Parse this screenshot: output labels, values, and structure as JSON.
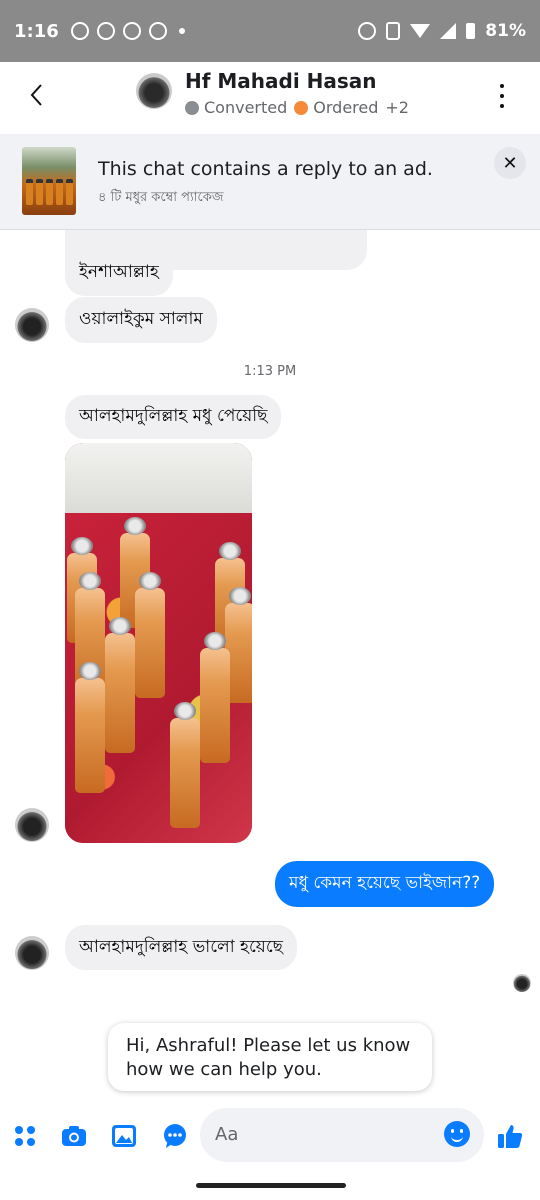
{
  "status_bar": {
    "time": "1:16",
    "battery": "81%"
  },
  "header": {
    "contact_name": "Hf Mahadi Hasan",
    "labels": [
      {
        "text": "Converted",
        "color": "#8a8d91"
      },
      {
        "text": "Ordered",
        "color": "#f58b3a"
      }
    ],
    "more_labels": "+2"
  },
  "ad_banner": {
    "title": "This chat contains a reply to an ad.",
    "subtitle": "৪ টি মধুর কম্বো প্যাকেজ"
  },
  "messages": {
    "partial_prev": "ইনশাআল্লাহ",
    "reply_salam": "ওয়ালাইকুম সালাম",
    "timestamp": "1:13 PM",
    "honey_received": "আলহামদুলিল্লাহ মধু পেয়েছি",
    "question_out": "মধু কেমন হয়েছে ভাইজান??",
    "answer_good": "আলহামদুলিল্লাহ ভালো হয়েছে"
  },
  "welcome_message": {
    "line1": "Hi, Ashraful! Please let us know",
    "line2": "how we can help you."
  },
  "composer": {
    "placeholder": "Aa"
  },
  "colors": {
    "accent": "#0a7cff",
    "incoming_bubble": "#f0f0f2",
    "banner_bg": "#f0f2f5"
  }
}
